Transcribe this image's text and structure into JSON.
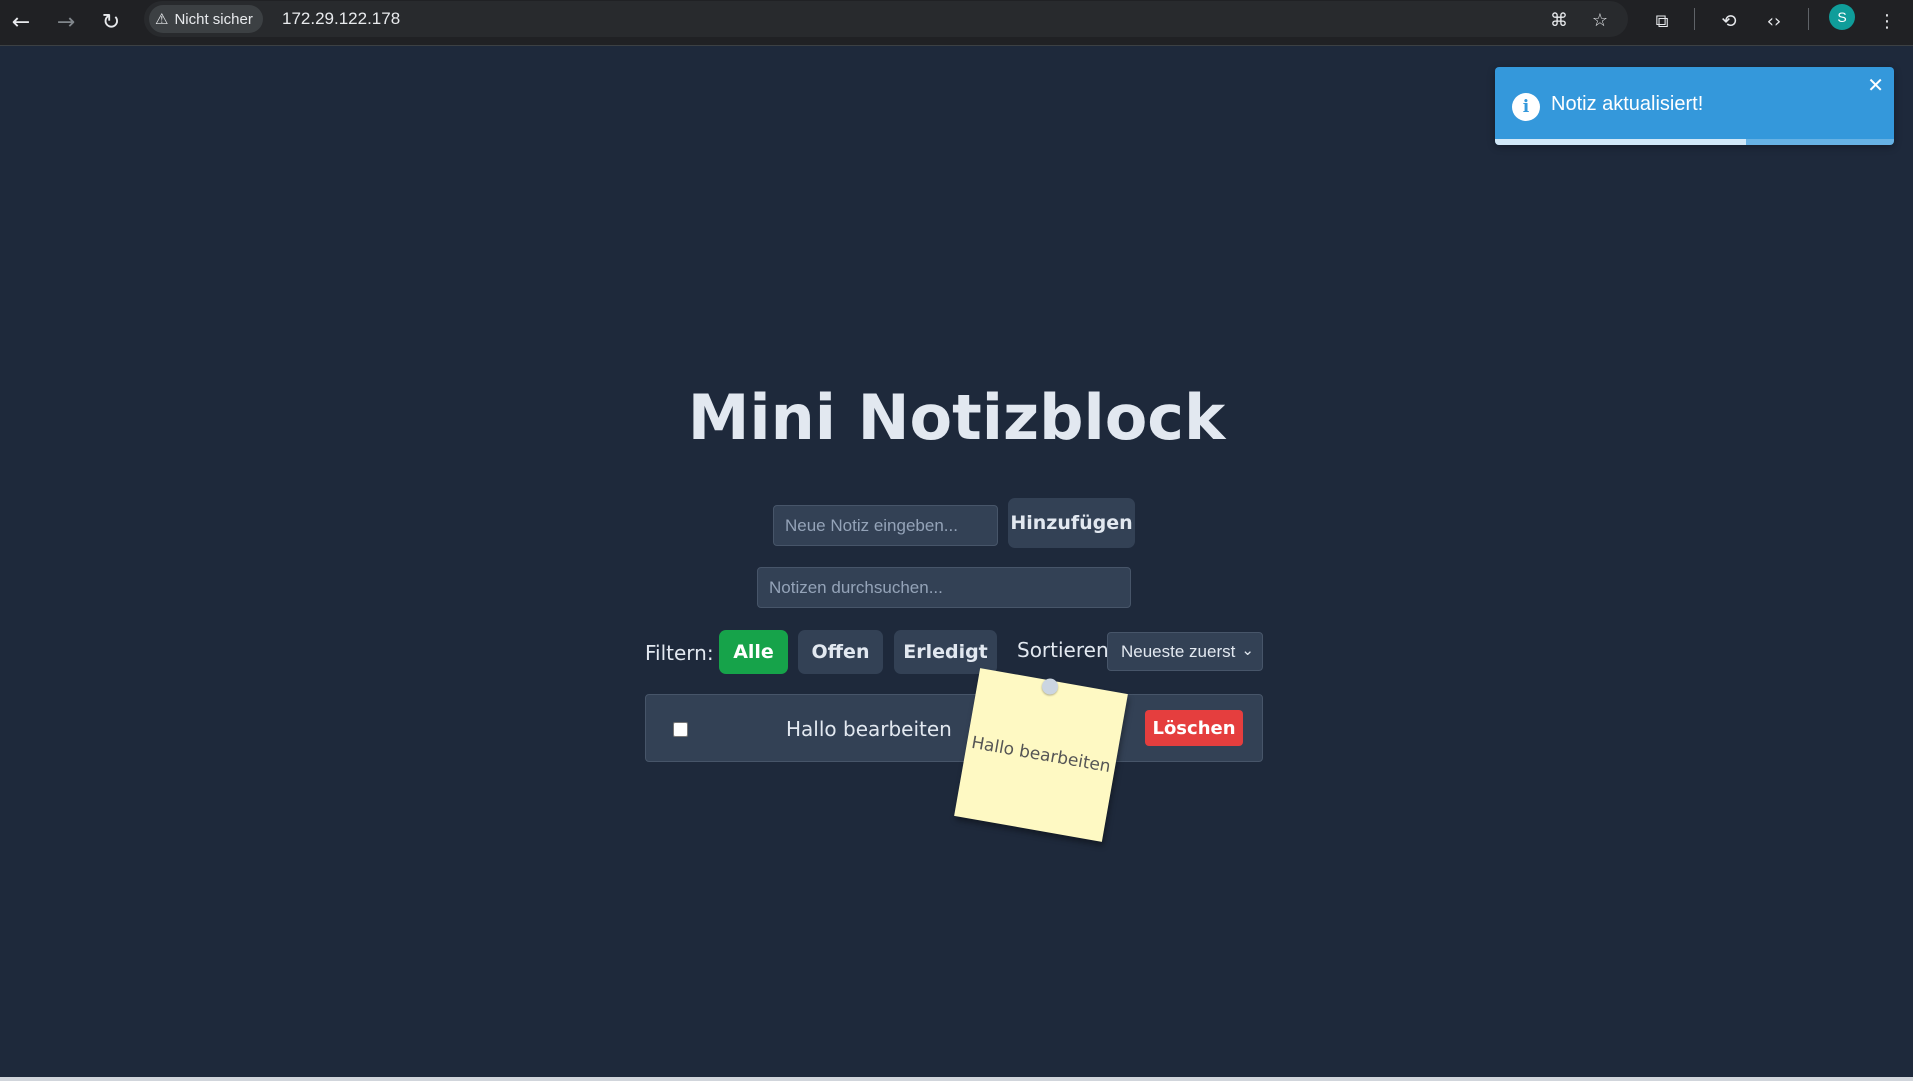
{
  "browser": {
    "security_label": "Nicht sicher",
    "url": "172.29.122.178",
    "profile_initial": "S"
  },
  "toast": {
    "message": "Notiz aktualisiert!",
    "close_symbol": "✕",
    "progress_fraction": 0.63,
    "color": "#3498db"
  },
  "app": {
    "title": "Mini Notizblock",
    "new_note_placeholder": "Neue Notiz eingeben...",
    "add_button": "Hinzufügen",
    "search_placeholder": "Notizen durchsuchen...",
    "filter_label": "Filtern:",
    "filters": [
      "Alle",
      "Offen",
      "Erledigt"
    ],
    "active_filter": "Alle",
    "sort_label": "Sortieren:",
    "sort_value": "Neueste zuerst",
    "notes": [
      {
        "text": "Hallo bearbeiten",
        "done": false,
        "delete_label": "Löschen"
      }
    ],
    "drag_preview_text": "Hallo bearbeiten",
    "colors": {
      "background": "#1e293b",
      "surface": "#334155",
      "active_filter": "#16a34a",
      "delete": "#e53e3e",
      "sticky": "#fef9c3"
    }
  }
}
